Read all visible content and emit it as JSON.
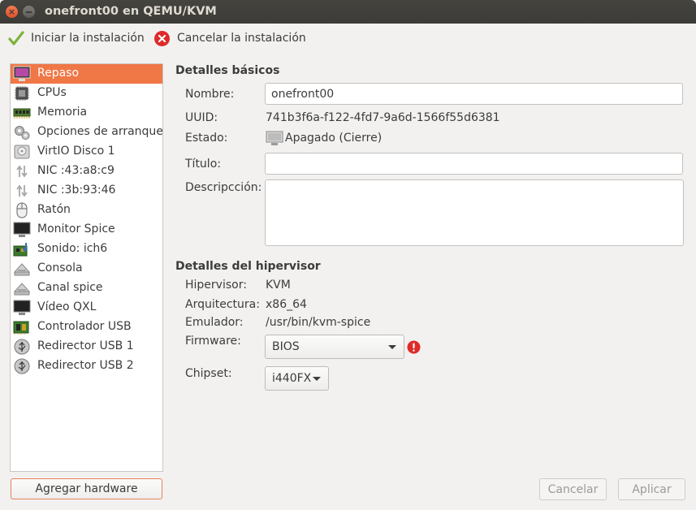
{
  "window": {
    "title": "onefront00 en QEMU/KVM"
  },
  "toolbar": {
    "start_label": "Iniciar la instalación",
    "cancel_label": "Cancelar la instalación"
  },
  "sidebar": {
    "items": [
      {
        "label": "Repaso",
        "icon": "monitor-overview-icon",
        "selected": true
      },
      {
        "label": "CPUs",
        "icon": "cpu-chip-icon"
      },
      {
        "label": "Memoria",
        "icon": "memory-module-icon"
      },
      {
        "label": "Opciones de arranque",
        "icon": "boot-gears-icon"
      },
      {
        "label": "VirtIO Disco 1",
        "icon": "hard-disk-icon"
      },
      {
        "label": "NIC :43:a8:c9",
        "icon": "network-arrows-icon"
      },
      {
        "label": "NIC :3b:93:46",
        "icon": "network-arrows-icon"
      },
      {
        "label": "Ratón",
        "icon": "mouse-icon"
      },
      {
        "label": "Monitor Spice",
        "icon": "display-icon"
      },
      {
        "label": "Sonido: ich6",
        "icon": "sound-card-icon"
      },
      {
        "label": "Consola",
        "icon": "serial-console-icon"
      },
      {
        "label": "Canal spice",
        "icon": "channel-icon"
      },
      {
        "label": "Vídeo QXL",
        "icon": "video-display-icon"
      },
      {
        "label": "Controlador USB",
        "icon": "usb-controller-icon"
      },
      {
        "label": "Redirector USB 1",
        "icon": "usb-redirector-icon"
      },
      {
        "label": "Redirector USB 2",
        "icon": "usb-redirector-icon"
      }
    ],
    "add_hardware_label": "Agregar hardware"
  },
  "basic": {
    "section_title": "Detalles básicos",
    "name_label": "Nombre:",
    "name_value": "onefront00",
    "uuid_label": "UUID:",
    "uuid_value": "741b3f6a-f122-4fd7-9a6d-1566f55d6381",
    "status_label": "Estado:",
    "status_value": "Apagado (Cierre)",
    "title_label": "Título:",
    "title_value": "",
    "description_label": "Descripcción:",
    "description_value": ""
  },
  "hypervisor": {
    "section_title": "Detalles del hipervisor",
    "hypervisor_label": "Hipervisor:",
    "hypervisor_value": "KVM",
    "arch_label": "Arquitectura:",
    "arch_value": "x86_64",
    "emulator_label": "Emulador:",
    "emulator_value": "/usr/bin/kvm-spice",
    "firmware_label": "Firmware:",
    "firmware_value": "BIOS",
    "chipset_label": "Chipset:",
    "chipset_value": "i440FX"
  },
  "footer": {
    "cancel_label": "Cancelar",
    "apply_label": "Aplicar"
  },
  "colors": {
    "selection": "#f07746",
    "titlebar": "#3c3b37",
    "close_button": "#e0532a",
    "warning": "#df2a2a"
  }
}
